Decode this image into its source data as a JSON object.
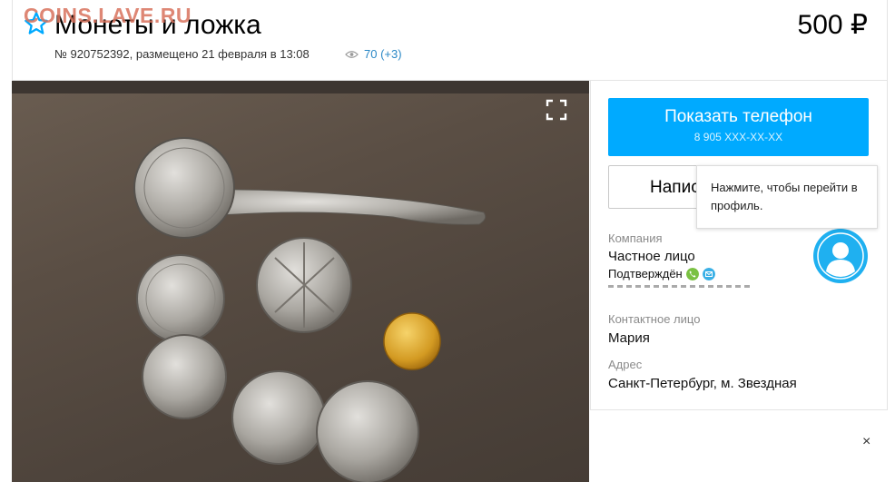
{
  "watermark": "COINS.LAVE.RU",
  "header": {
    "title": "Монеты и ложка",
    "price": "500 ₽",
    "meta": "№ 920752392, размещено 21 февраля в 13:08",
    "views": "70 (+3)",
    "favorite_icon": "star-outline-icon"
  },
  "photo": {
    "fullscreen_icon": "fullscreen-icon"
  },
  "sidebar": {
    "phone_button": {
      "label": "Показать телефон",
      "number": "8 905 XXX-XX-XX"
    },
    "write_button": {
      "label": "Написать сообщение"
    },
    "tooltip": "Нажмите, чтобы перейти в профиль.",
    "company": {
      "label": "Компания",
      "value": "Частное лицо",
      "verified": "Подтверждён"
    },
    "contact": {
      "label": "Контактное лицо",
      "value": "Мария"
    },
    "address": {
      "label": "Адрес",
      "value": "Санкт-Петербург, м. Звездная"
    }
  },
  "close_icon": "×",
  "colors": {
    "accent": "#00aaff",
    "verify_phone": "#7ac142",
    "verify_mail": "#3ab0e6"
  }
}
